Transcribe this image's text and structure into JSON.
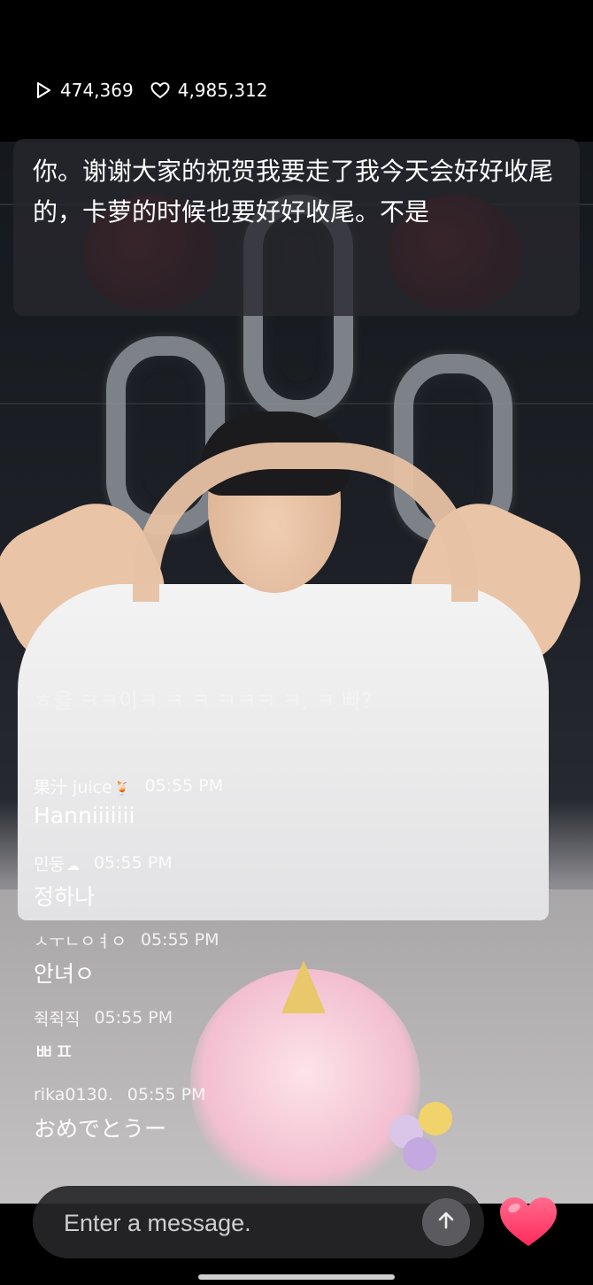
{
  "stats": {
    "views": "474,369",
    "likes": "4,985,312",
    "views_icon": "play-icon",
    "likes_icon": "heart-outline-icon"
  },
  "subtitle": {
    "text": "你。谢谢大家的祝贺我要走了我今天会好好收尾的，卡萝的时候也要好好收尾。不是"
  },
  "chat": {
    "faded_text": "ㅎ을 ㅋㅋ이ㅋ ㅋ ㅋ ㅋㅋㅋ ㅋ, ㅋ 빠?",
    "messages": [
      {
        "user": "果汁 juice",
        "badge": "🍹",
        "time": "05:55 PM",
        "text": "Hanniiiiiii"
      },
      {
        "user": "민둥",
        "badge": "☁",
        "time": "05:55 PM",
        "text": "정하나"
      },
      {
        "user": "ㅅㅜㄴㅇㅕㅇ",
        "badge": "",
        "time": "05:55 PM",
        "text": "안녀ㅇ"
      },
      {
        "user": "쥑쥑직",
        "badge": "",
        "time": "05:55 PM",
        "text": "ㅃㅍ"
      },
      {
        "user": "rika0130.",
        "badge": "",
        "time": "05:55 PM",
        "text": "おめでとうー"
      }
    ]
  },
  "input": {
    "placeholder": "Enter a message.",
    "send_icon": "arrow-up-icon",
    "heart_icon": "heart-icon"
  },
  "colors": {
    "heart": "#ff3f6c",
    "send_button": "#5b5b5f",
    "subtitle_bg": "#28282e"
  }
}
